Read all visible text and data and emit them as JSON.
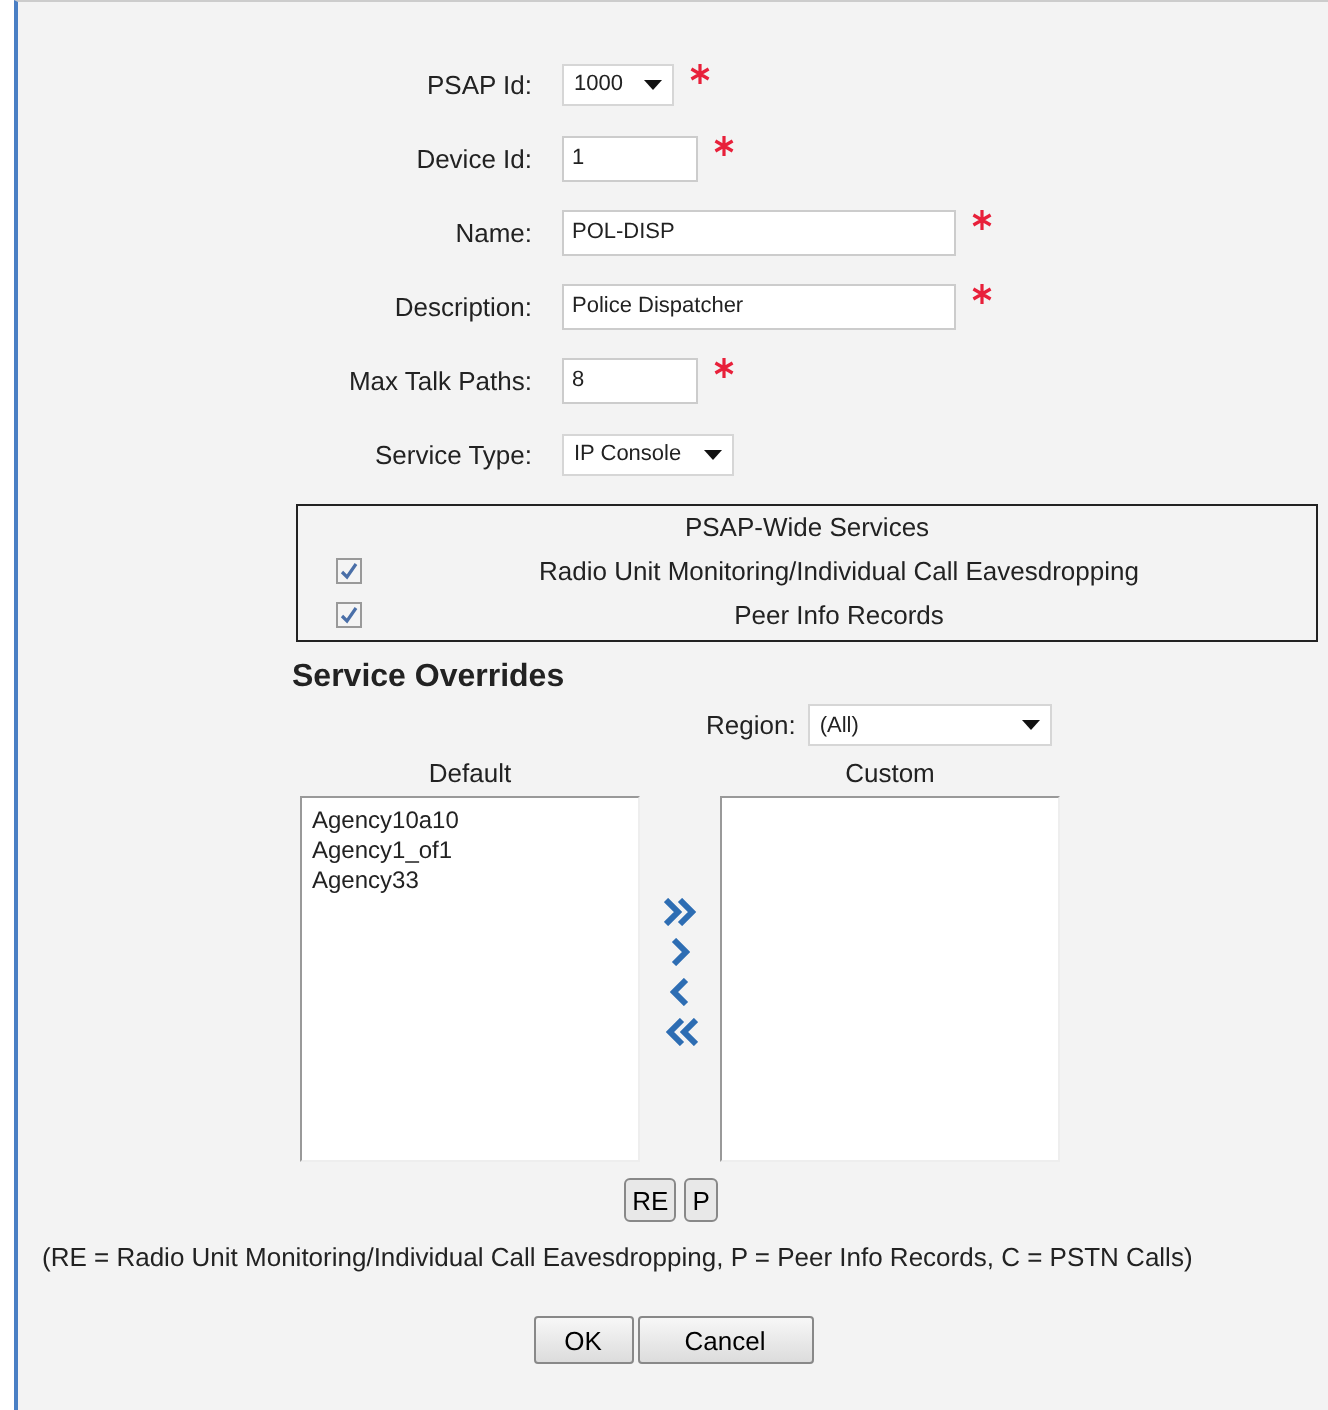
{
  "fields": [
    {
      "label": "PSAP Id:",
      "kind": "select",
      "value": "1000",
      "required": true
    },
    {
      "label": "Device Id:",
      "kind": "text",
      "value": "1",
      "required": true
    },
    {
      "label": "Name:",
      "kind": "text",
      "value": "POL-DISP",
      "required": true
    },
    {
      "label": "Description:",
      "kind": "text",
      "value": "Police Dispatcher",
      "required": true
    },
    {
      "label": "Max Talk Paths:",
      "kind": "text",
      "value": "8",
      "required": true
    },
    {
      "label": "Service Type:",
      "kind": "select",
      "value": "IP Console",
      "required": false
    }
  ],
  "psap_wide_services": {
    "title": "PSAP-Wide Services",
    "items": [
      {
        "label": "Radio Unit Monitoring/Individual Call Eavesdropping",
        "checked": true
      },
      {
        "label": "Peer Info Records",
        "checked": true
      }
    ]
  },
  "service_overrides": {
    "title": "Service Overrides",
    "region_label": "Region:",
    "region_value": "(All)",
    "default_title": "Default",
    "default_items": [
      "Agency10a10",
      "Agency1_of1",
      "Agency33"
    ],
    "custom_title": "Custom",
    "service_buttons": [
      "RE",
      "P"
    ],
    "legend": "(RE = Radio Unit Monitoring/Individual Call Eavesdropping, P = Peer Info Records, C = PSTN Calls)"
  },
  "buttons": [
    "OK",
    "Cancel"
  ]
}
